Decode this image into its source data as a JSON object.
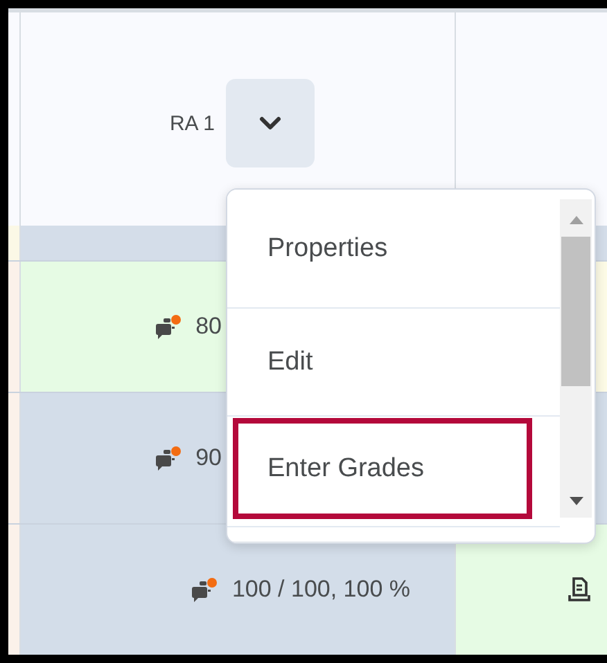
{
  "header": {
    "column_label": "RA 1"
  },
  "rows": [
    {
      "grade": "80",
      "covered_by_menu": true,
      "color": "#e6fbe4",
      "right_cell": {
        "color": "#fdfbe6"
      }
    },
    {
      "grade": "90",
      "covered_by_menu": true,
      "color": "#d3dde9",
      "right_cell": {
        "color": "#d3dde9"
      }
    },
    {
      "grade": "100 / 100, 100 %",
      "covered_by_menu": false,
      "color": "#d3dde9",
      "right_cell": {
        "color": "#e6fbe4",
        "submission_icon": true
      }
    }
  ],
  "menu": {
    "items": [
      {
        "label": "Properties",
        "highlighted": false
      },
      {
        "label": "Edit",
        "highlighted": false
      },
      {
        "label": "Enter Grades",
        "highlighted": true
      }
    ]
  }
}
